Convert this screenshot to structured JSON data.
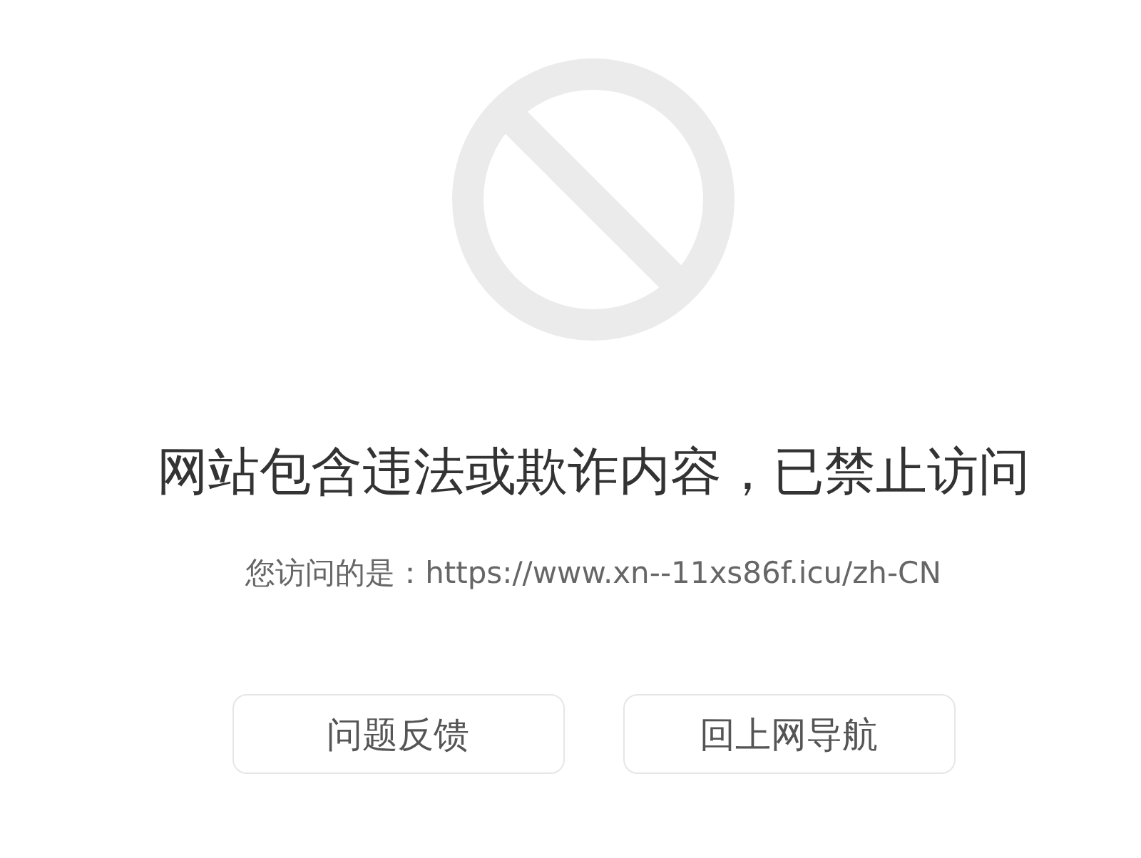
{
  "title": "网站包含违法或欺诈内容，已禁止访问",
  "subtitle": "您访问的是：https://www.xn--11xs86f.icu/zh-CN",
  "buttons": [
    "问题反馈",
    "回上网导航"
  ]
}
